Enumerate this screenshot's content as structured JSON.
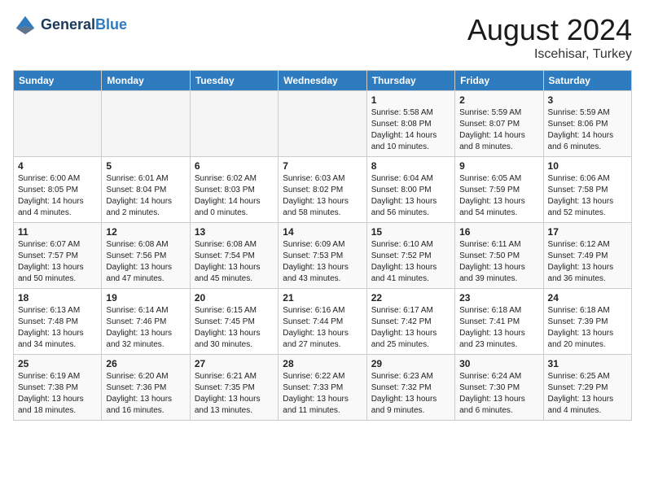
{
  "logo": {
    "line1": "General",
    "line2": "Blue"
  },
  "title": "August 2024",
  "location": "Iscehisar, Turkey",
  "headers": [
    "Sunday",
    "Monday",
    "Tuesday",
    "Wednesday",
    "Thursday",
    "Friday",
    "Saturday"
  ],
  "weeks": [
    [
      {
        "day": "",
        "content": ""
      },
      {
        "day": "",
        "content": ""
      },
      {
        "day": "",
        "content": ""
      },
      {
        "day": "",
        "content": ""
      },
      {
        "day": "1",
        "content": "Sunrise: 5:58 AM\nSunset: 8:08 PM\nDaylight: 14 hours and 10 minutes."
      },
      {
        "day": "2",
        "content": "Sunrise: 5:59 AM\nSunset: 8:07 PM\nDaylight: 14 hours and 8 minutes."
      },
      {
        "day": "3",
        "content": "Sunrise: 5:59 AM\nSunset: 8:06 PM\nDaylight: 14 hours and 6 minutes."
      }
    ],
    [
      {
        "day": "4",
        "content": "Sunrise: 6:00 AM\nSunset: 8:05 PM\nDaylight: 14 hours and 4 minutes."
      },
      {
        "day": "5",
        "content": "Sunrise: 6:01 AM\nSunset: 8:04 PM\nDaylight: 14 hours and 2 minutes."
      },
      {
        "day": "6",
        "content": "Sunrise: 6:02 AM\nSunset: 8:03 PM\nDaylight: 14 hours and 0 minutes."
      },
      {
        "day": "7",
        "content": "Sunrise: 6:03 AM\nSunset: 8:02 PM\nDaylight: 13 hours and 58 minutes."
      },
      {
        "day": "8",
        "content": "Sunrise: 6:04 AM\nSunset: 8:00 PM\nDaylight: 13 hours and 56 minutes."
      },
      {
        "day": "9",
        "content": "Sunrise: 6:05 AM\nSunset: 7:59 PM\nDaylight: 13 hours and 54 minutes."
      },
      {
        "day": "10",
        "content": "Sunrise: 6:06 AM\nSunset: 7:58 PM\nDaylight: 13 hours and 52 minutes."
      }
    ],
    [
      {
        "day": "11",
        "content": "Sunrise: 6:07 AM\nSunset: 7:57 PM\nDaylight: 13 hours and 50 minutes."
      },
      {
        "day": "12",
        "content": "Sunrise: 6:08 AM\nSunset: 7:56 PM\nDaylight: 13 hours and 47 minutes."
      },
      {
        "day": "13",
        "content": "Sunrise: 6:08 AM\nSunset: 7:54 PM\nDaylight: 13 hours and 45 minutes."
      },
      {
        "day": "14",
        "content": "Sunrise: 6:09 AM\nSunset: 7:53 PM\nDaylight: 13 hours and 43 minutes."
      },
      {
        "day": "15",
        "content": "Sunrise: 6:10 AM\nSunset: 7:52 PM\nDaylight: 13 hours and 41 minutes."
      },
      {
        "day": "16",
        "content": "Sunrise: 6:11 AM\nSunset: 7:50 PM\nDaylight: 13 hours and 39 minutes."
      },
      {
        "day": "17",
        "content": "Sunrise: 6:12 AM\nSunset: 7:49 PM\nDaylight: 13 hours and 36 minutes."
      }
    ],
    [
      {
        "day": "18",
        "content": "Sunrise: 6:13 AM\nSunset: 7:48 PM\nDaylight: 13 hours and 34 minutes."
      },
      {
        "day": "19",
        "content": "Sunrise: 6:14 AM\nSunset: 7:46 PM\nDaylight: 13 hours and 32 minutes."
      },
      {
        "day": "20",
        "content": "Sunrise: 6:15 AM\nSunset: 7:45 PM\nDaylight: 13 hours and 30 minutes."
      },
      {
        "day": "21",
        "content": "Sunrise: 6:16 AM\nSunset: 7:44 PM\nDaylight: 13 hours and 27 minutes."
      },
      {
        "day": "22",
        "content": "Sunrise: 6:17 AM\nSunset: 7:42 PM\nDaylight: 13 hours and 25 minutes."
      },
      {
        "day": "23",
        "content": "Sunrise: 6:18 AM\nSunset: 7:41 PM\nDaylight: 13 hours and 23 minutes."
      },
      {
        "day": "24",
        "content": "Sunrise: 6:18 AM\nSunset: 7:39 PM\nDaylight: 13 hours and 20 minutes."
      }
    ],
    [
      {
        "day": "25",
        "content": "Sunrise: 6:19 AM\nSunset: 7:38 PM\nDaylight: 13 hours and 18 minutes."
      },
      {
        "day": "26",
        "content": "Sunrise: 6:20 AM\nSunset: 7:36 PM\nDaylight: 13 hours and 16 minutes."
      },
      {
        "day": "27",
        "content": "Sunrise: 6:21 AM\nSunset: 7:35 PM\nDaylight: 13 hours and 13 minutes."
      },
      {
        "day": "28",
        "content": "Sunrise: 6:22 AM\nSunset: 7:33 PM\nDaylight: 13 hours and 11 minutes."
      },
      {
        "day": "29",
        "content": "Sunrise: 6:23 AM\nSunset: 7:32 PM\nDaylight: 13 hours and 9 minutes."
      },
      {
        "day": "30",
        "content": "Sunrise: 6:24 AM\nSunset: 7:30 PM\nDaylight: 13 hours and 6 minutes."
      },
      {
        "day": "31",
        "content": "Sunrise: 6:25 AM\nSunset: 7:29 PM\nDaylight: 13 hours and 4 minutes."
      }
    ]
  ]
}
